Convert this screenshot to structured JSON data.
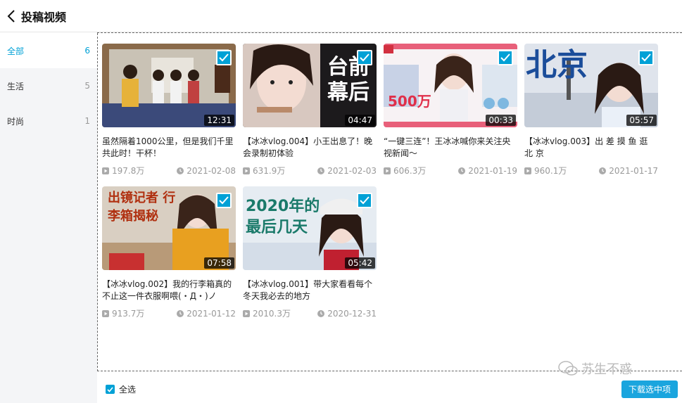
{
  "header": {
    "title": "投稿视频"
  },
  "sidebar": {
    "items": [
      {
        "label": "全部",
        "count": "6"
      },
      {
        "label": "生活",
        "count": "5"
      },
      {
        "label": "时尚",
        "count": "1"
      }
    ]
  },
  "videos": [
    {
      "duration": "12:31",
      "title": "虽然隔着1000公里，但是我们千里共此时！干杯！",
      "views": "197.8万",
      "date": "2021-02-08",
      "overlay": ""
    },
    {
      "duration": "04:47",
      "title": "【冰冰vlog.004】小王出息了！晚会录制初体验",
      "views": "631.9万",
      "date": "2021-02-03",
      "overlay": "台前幕后"
    },
    {
      "duration": "00:33",
      "title": "“一键三连”！王冰冰喊你来关注央视新闻～",
      "views": "606.3万",
      "date": "2021-01-19",
      "overlay": "500万"
    },
    {
      "duration": "05:57",
      "title": "【冰冰vlog.003】出 差 摸 鱼 逛 北 京",
      "views": "960.1万",
      "date": "2021-01-17",
      "overlay": "北京"
    },
    {
      "duration": "07:58",
      "title": "【冰冰vlog.002】我的行李箱真的不止这一件衣服啊喂(・Д・)ノ",
      "views": "913.7万",
      "date": "2021-01-12",
      "overlay": "出镜记者 行李箱揭秘"
    },
    {
      "duration": "05:42",
      "title": "【冰冰vlog.001】带大家看看每个冬天我必去的地方",
      "views": "2010.3万",
      "date": "2020-12-31",
      "overlay": "2020年的最后几天"
    }
  ],
  "footer": {
    "select_all": "全选",
    "download": "下载选中项"
  },
  "watermark": "苏生不惑",
  "colors": {
    "accent": "#00a1d6"
  }
}
